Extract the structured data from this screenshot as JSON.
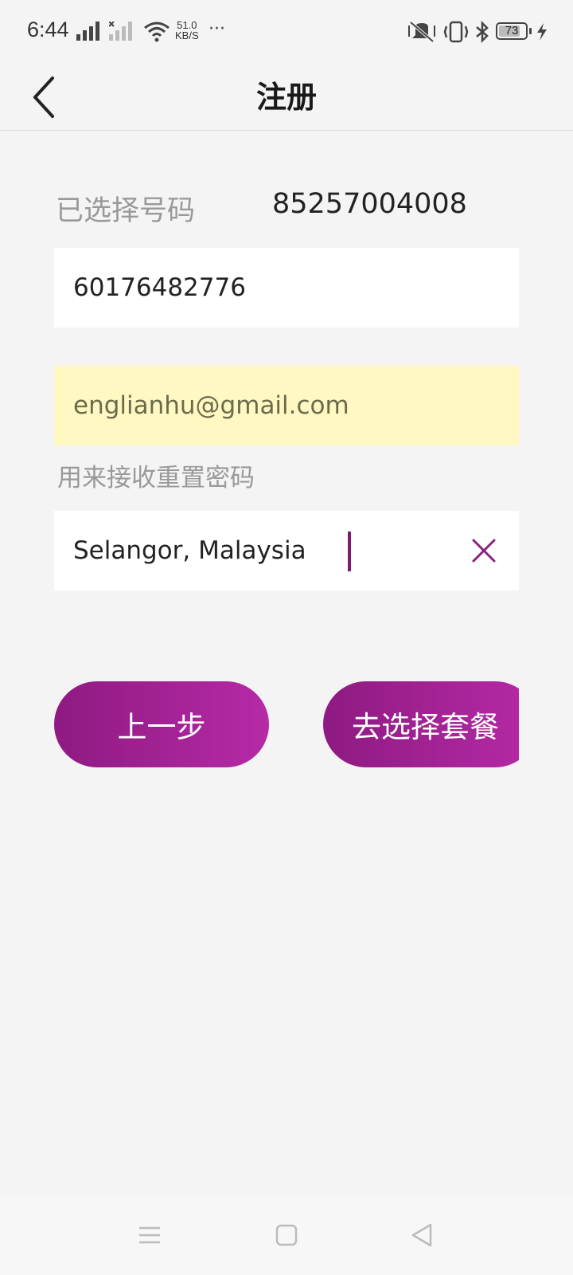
{
  "status_bar": {
    "time": "6:44",
    "net_speed_value": "51.0",
    "net_speed_unit": "KB/S",
    "battery_level": "73",
    "icons": [
      "signal-icon",
      "signal-no-service-icon",
      "wifi-icon",
      "more-icon",
      "mute-vibrate-icon",
      "vibrate-icon",
      "bluetooth-icon",
      "battery-icon",
      "charging-icon"
    ]
  },
  "header": {
    "title": "注册",
    "back_icon": "chevron-left-icon"
  },
  "form": {
    "selected_label": "已选择号码",
    "selected_value": "85257004008",
    "phone_value": "60176482776",
    "email_value": "englianhu@gmail.com",
    "email_hint": "用来接收重置密码",
    "region_value": "Selangor, Malaysia",
    "clear_icon": "close-icon"
  },
  "buttons": {
    "prev_label": "上一步",
    "next_label": "去选择套餐"
  },
  "colors": {
    "accent": "#9c1f8e",
    "accent_light": "#b62aa6",
    "autofill_bg": "#fff8c3",
    "background": "#f4f4f4"
  },
  "nav_bar": {
    "icons": [
      "menu-icon",
      "home-square-icon",
      "back-triangle-icon"
    ]
  }
}
